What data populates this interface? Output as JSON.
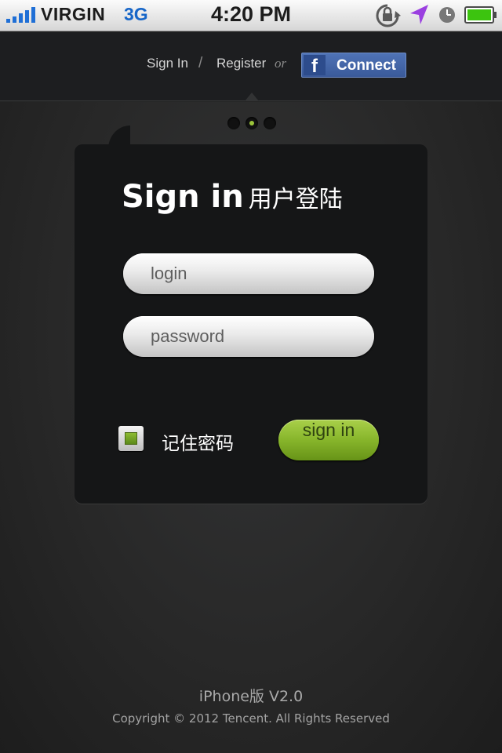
{
  "status_bar": {
    "carrier": "VIRGIN",
    "network": "3G",
    "time": "4:20 PM",
    "icons": [
      "signal-bars-icon",
      "rotation-lock-icon",
      "location-arrow-icon",
      "alarm-clock-icon",
      "battery-icon"
    ],
    "colors": {
      "signal": "#1f6fd6",
      "location": "#9a3fe0",
      "battery": "#3cc40f"
    }
  },
  "header": {
    "sign_in": "Sign In",
    "separator": "/",
    "register": "Register",
    "or": "or",
    "facebook_icon": "f",
    "facebook_connect": "Connect"
  },
  "pager": {
    "pages": 3,
    "active_index": 1,
    "active_color": "#9bc43a"
  },
  "login_card": {
    "title_en": "Sign in",
    "title_cn": "用户登陆",
    "login_placeholder": "login",
    "password_placeholder": "password",
    "remember_label": "记住密码",
    "remember_checked": true,
    "submit_label": "sign in",
    "accent_color": "#8ab830"
  },
  "footer": {
    "version": "iPhone版 V2.0",
    "copyright": "Copyright © 2012 Tencent. All Rights Reserved"
  }
}
